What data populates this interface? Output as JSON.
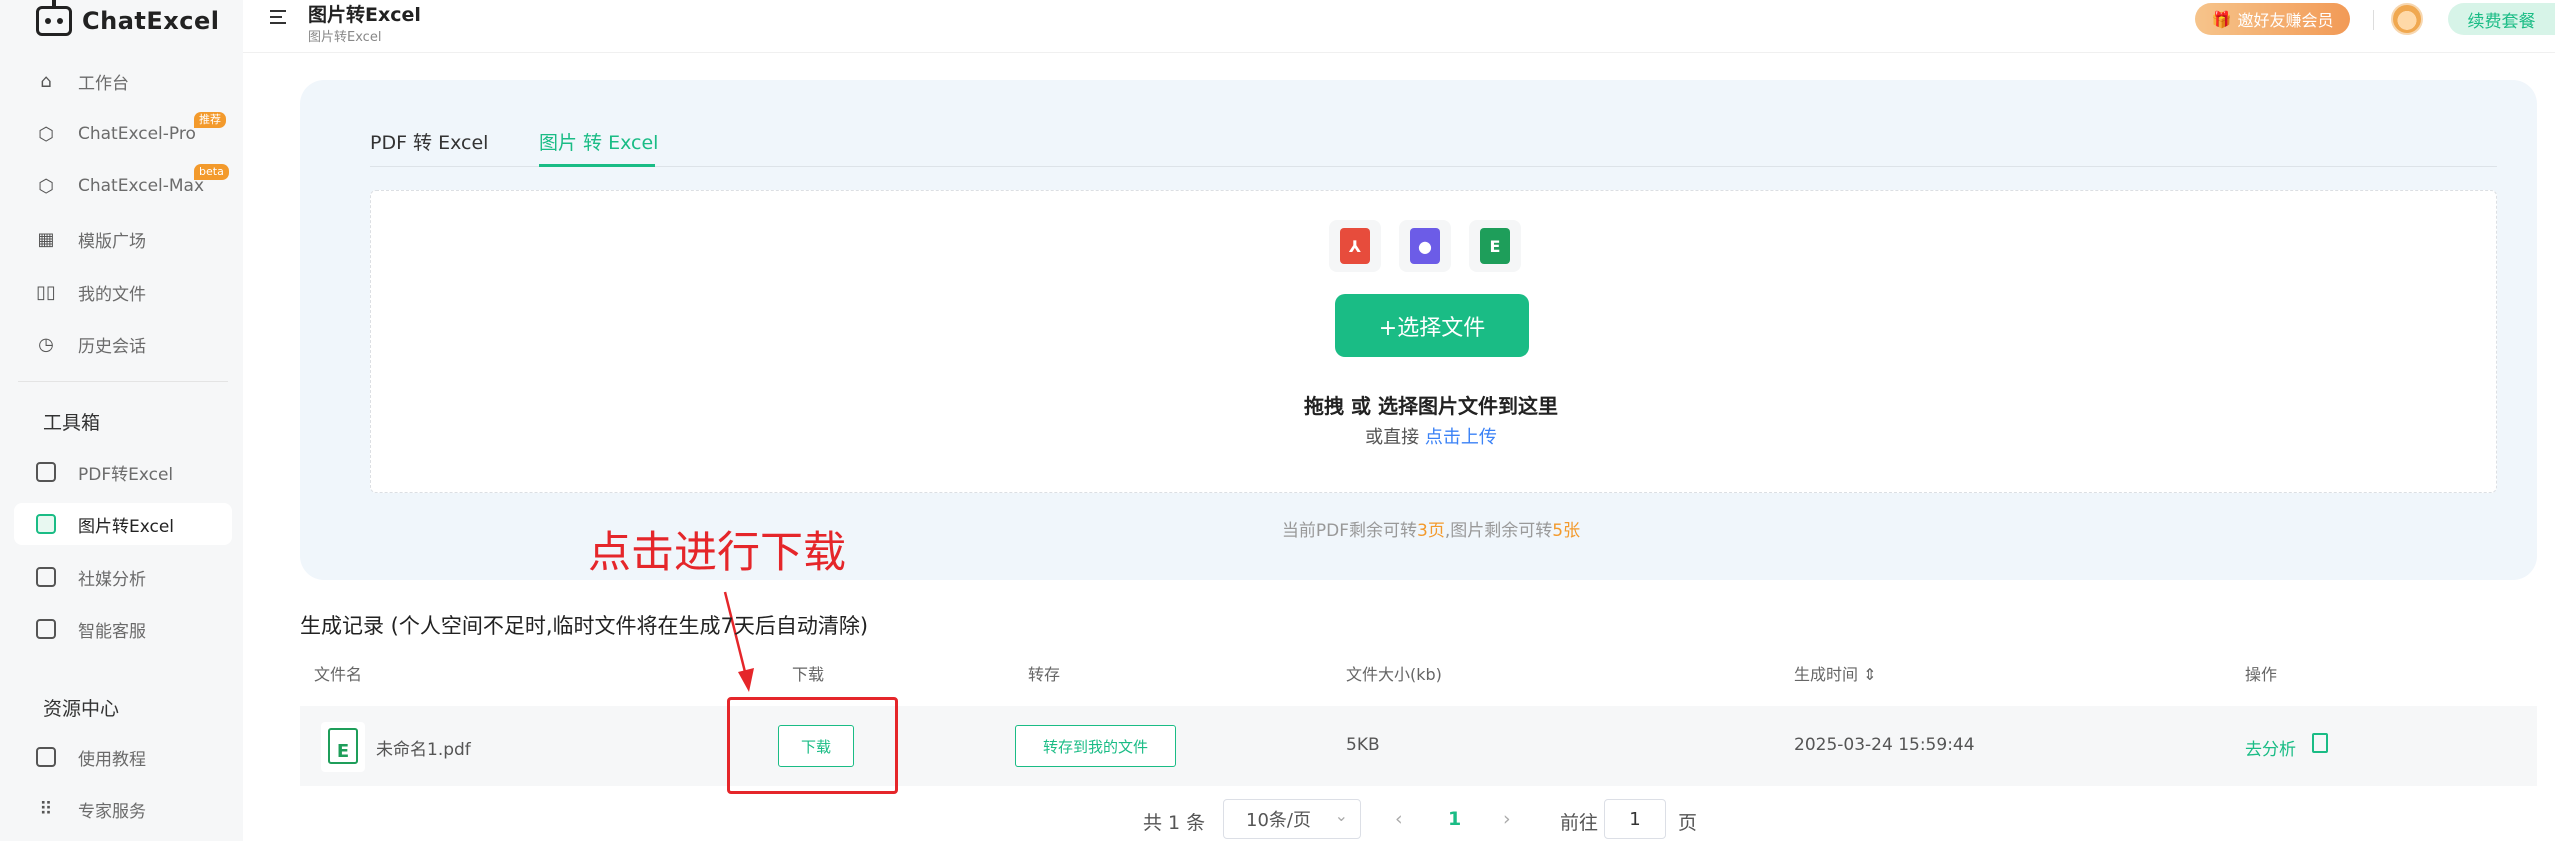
{
  "brand": {
    "name": "ChatExcel"
  },
  "sidebar": {
    "items": [
      {
        "label": "工作台"
      },
      {
        "label": "ChatExcel-Pro",
        "badge": "推荐"
      },
      {
        "label": "ChatExcel-Max",
        "badge": "beta"
      },
      {
        "label": "模版广场"
      },
      {
        "label": "我的文件"
      },
      {
        "label": "历史会话"
      }
    ],
    "toolbox_title": "工具箱",
    "tools": [
      {
        "label": "PDF转Excel"
      },
      {
        "label": "图片转Excel"
      },
      {
        "label": "社媒分析"
      },
      {
        "label": "智能客服"
      }
    ],
    "resources_title": "资源中心",
    "resources": [
      {
        "label": "使用教程"
      },
      {
        "label": "专家服务"
      }
    ]
  },
  "header": {
    "title": "图片转Excel",
    "breadcrumb": "图片转Excel",
    "invite_label": "邀好友赚会员",
    "renew_label": "续费套餐"
  },
  "converter": {
    "tabs": [
      {
        "label": "PDF 转 Excel"
      },
      {
        "label": "图片 转 Excel"
      }
    ],
    "choose_button": "+选择文件",
    "drag_text": "拖拽 或 选择图片文件到这里",
    "or_text": "或直接",
    "upload_link": "点击上传",
    "remain_prefix": "当前PDF剩余可转",
    "remain_pdf": "3页",
    "remain_mid": ",图片剩余可转",
    "remain_img": "5张"
  },
  "annotation": {
    "text": "点击进行下载"
  },
  "records": {
    "title": "生成记录 (个人空间不足时,临时文件将在生成7天后自动清除)",
    "columns": [
      "文件名",
      "下载",
      "转存",
      "文件大小(kb)",
      "生成时间 ⇕",
      "操作"
    ],
    "rows": [
      {
        "filename": "未命名1.pdf",
        "download": "下载",
        "save": "转存到我的文件",
        "size": "5KB",
        "time": "2025-03-24 15:59:44",
        "analyze": "去分析"
      }
    ]
  },
  "pagination": {
    "total": "共 1 条",
    "page_size": "10条/页",
    "current": "1",
    "goto_label": "前往",
    "goto_value": "1",
    "page_suffix": "页"
  },
  "colors": {
    "accent": "#1abc85",
    "annotation": "#e5262a",
    "highlight": "#f39a2c"
  }
}
